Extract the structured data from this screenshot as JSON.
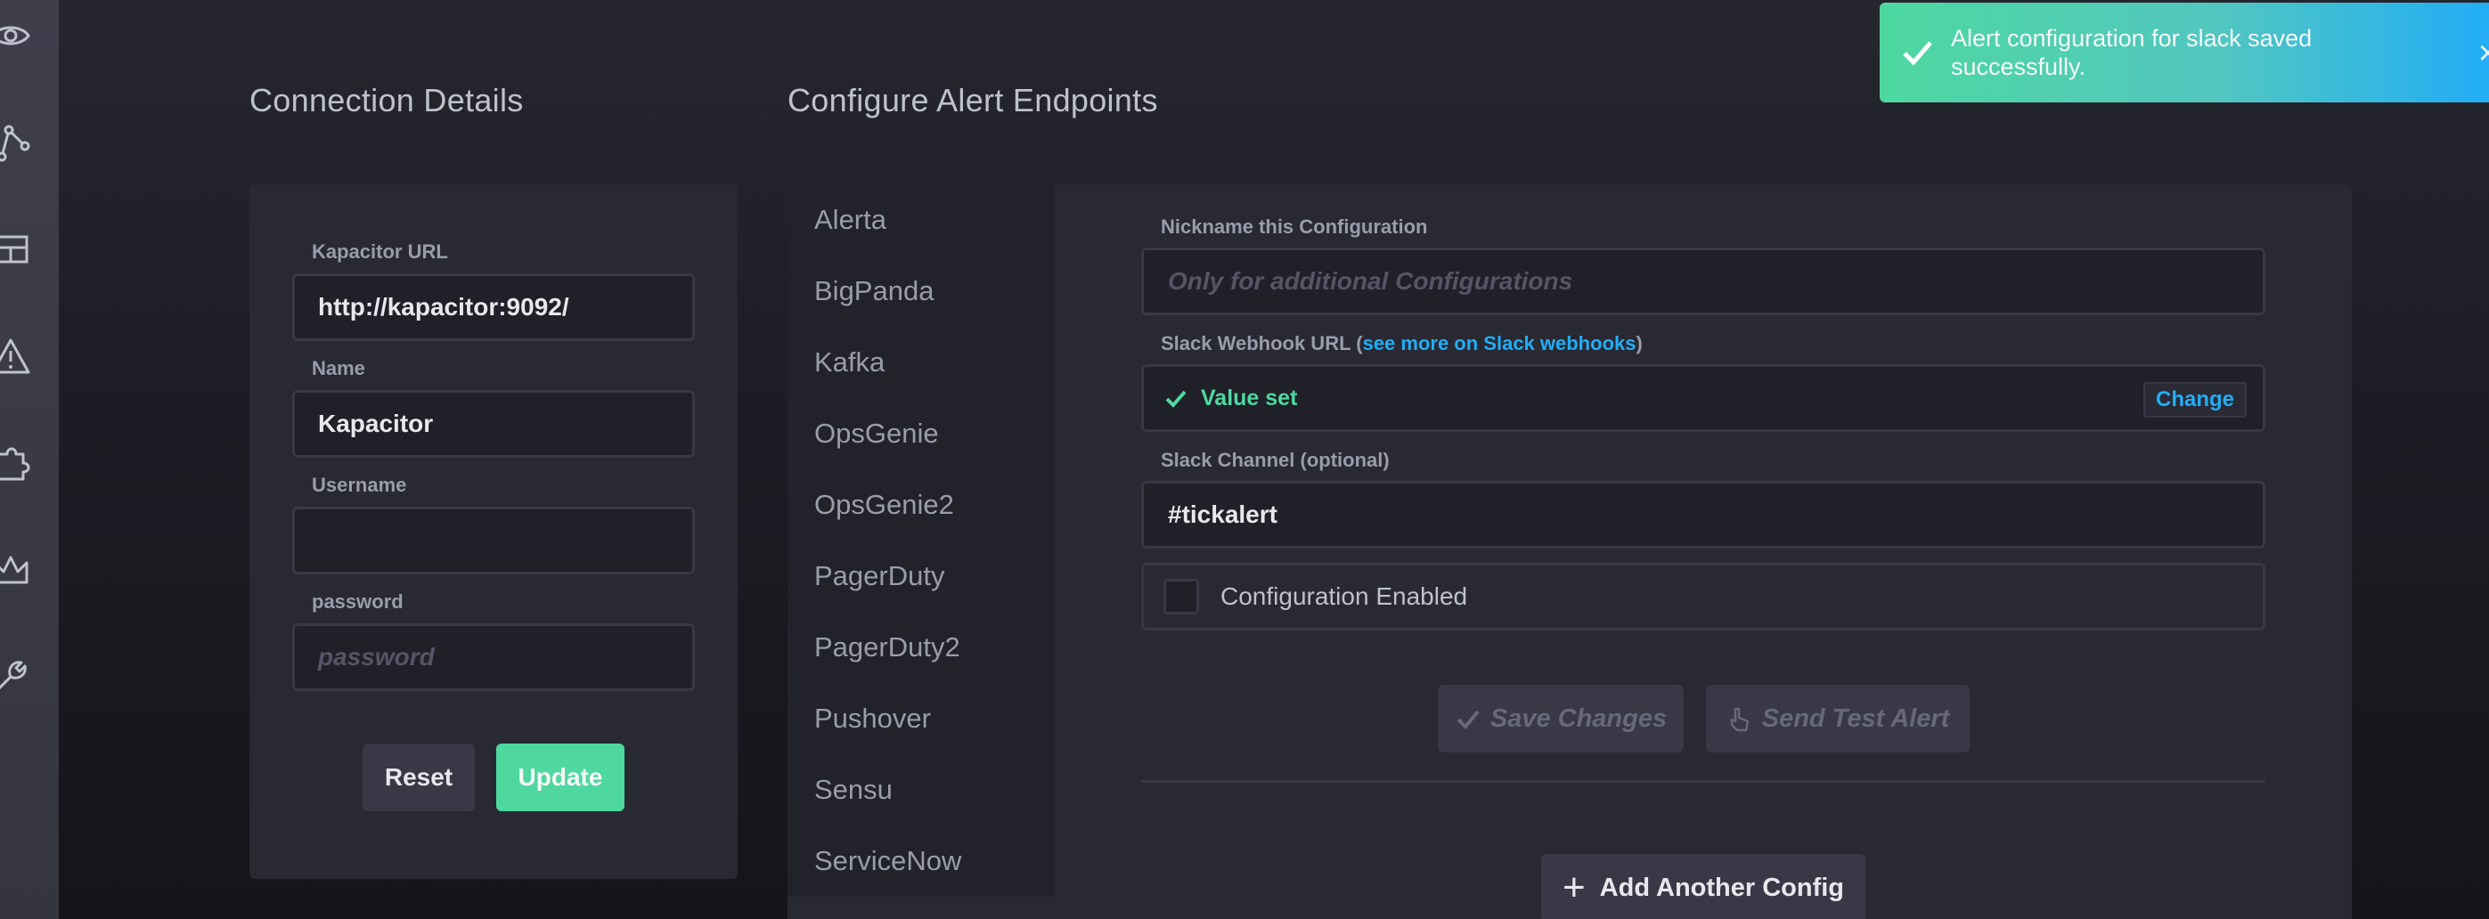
{
  "nav": {
    "icons": [
      "eye-icon",
      "graph-icon",
      "dashboard-icon",
      "alert-icon",
      "puzzle-icon",
      "crown-icon",
      "wrench-icon"
    ]
  },
  "connection": {
    "title": "Connection Details",
    "url_label": "Kapacitor URL",
    "url_value": "http://kapacitor:9092/",
    "name_label": "Name",
    "name_value": "Kapacitor",
    "username_label": "Username",
    "username_value": "",
    "password_label": "password",
    "password_placeholder": "password",
    "reset_label": "Reset",
    "update_label": "Update"
  },
  "alerts": {
    "title": "Configure Alert Endpoints",
    "endpoints": [
      "Alerta",
      "BigPanda",
      "Kafka",
      "OpsGenie",
      "OpsGenie2",
      "PagerDuty",
      "PagerDuty2",
      "Pushover",
      "Sensu",
      "ServiceNow"
    ],
    "nickname_label": "Nickname this Configuration",
    "nickname_placeholder": "Only for additional Configurations",
    "webhook_label_prefix": "Slack Webhook URL (",
    "webhook_link": "see more on Slack webhooks",
    "webhook_label_suffix": ")",
    "webhook_status": "Value set",
    "change_label": "Change",
    "channel_label": "Slack Channel (optional)",
    "channel_value": "#tickalert",
    "enabled_label": "Configuration Enabled",
    "enabled": false,
    "save_label": "Save Changes",
    "test_label": "Send Test Alert",
    "add_label": "Add Another Config"
  },
  "toast": {
    "message": "Alert configuration for slack saved successfully.",
    "close": "×"
  },
  "colors": {
    "success": "#4ed8a0",
    "link": "#22adf6",
    "panel": "#292933"
  }
}
